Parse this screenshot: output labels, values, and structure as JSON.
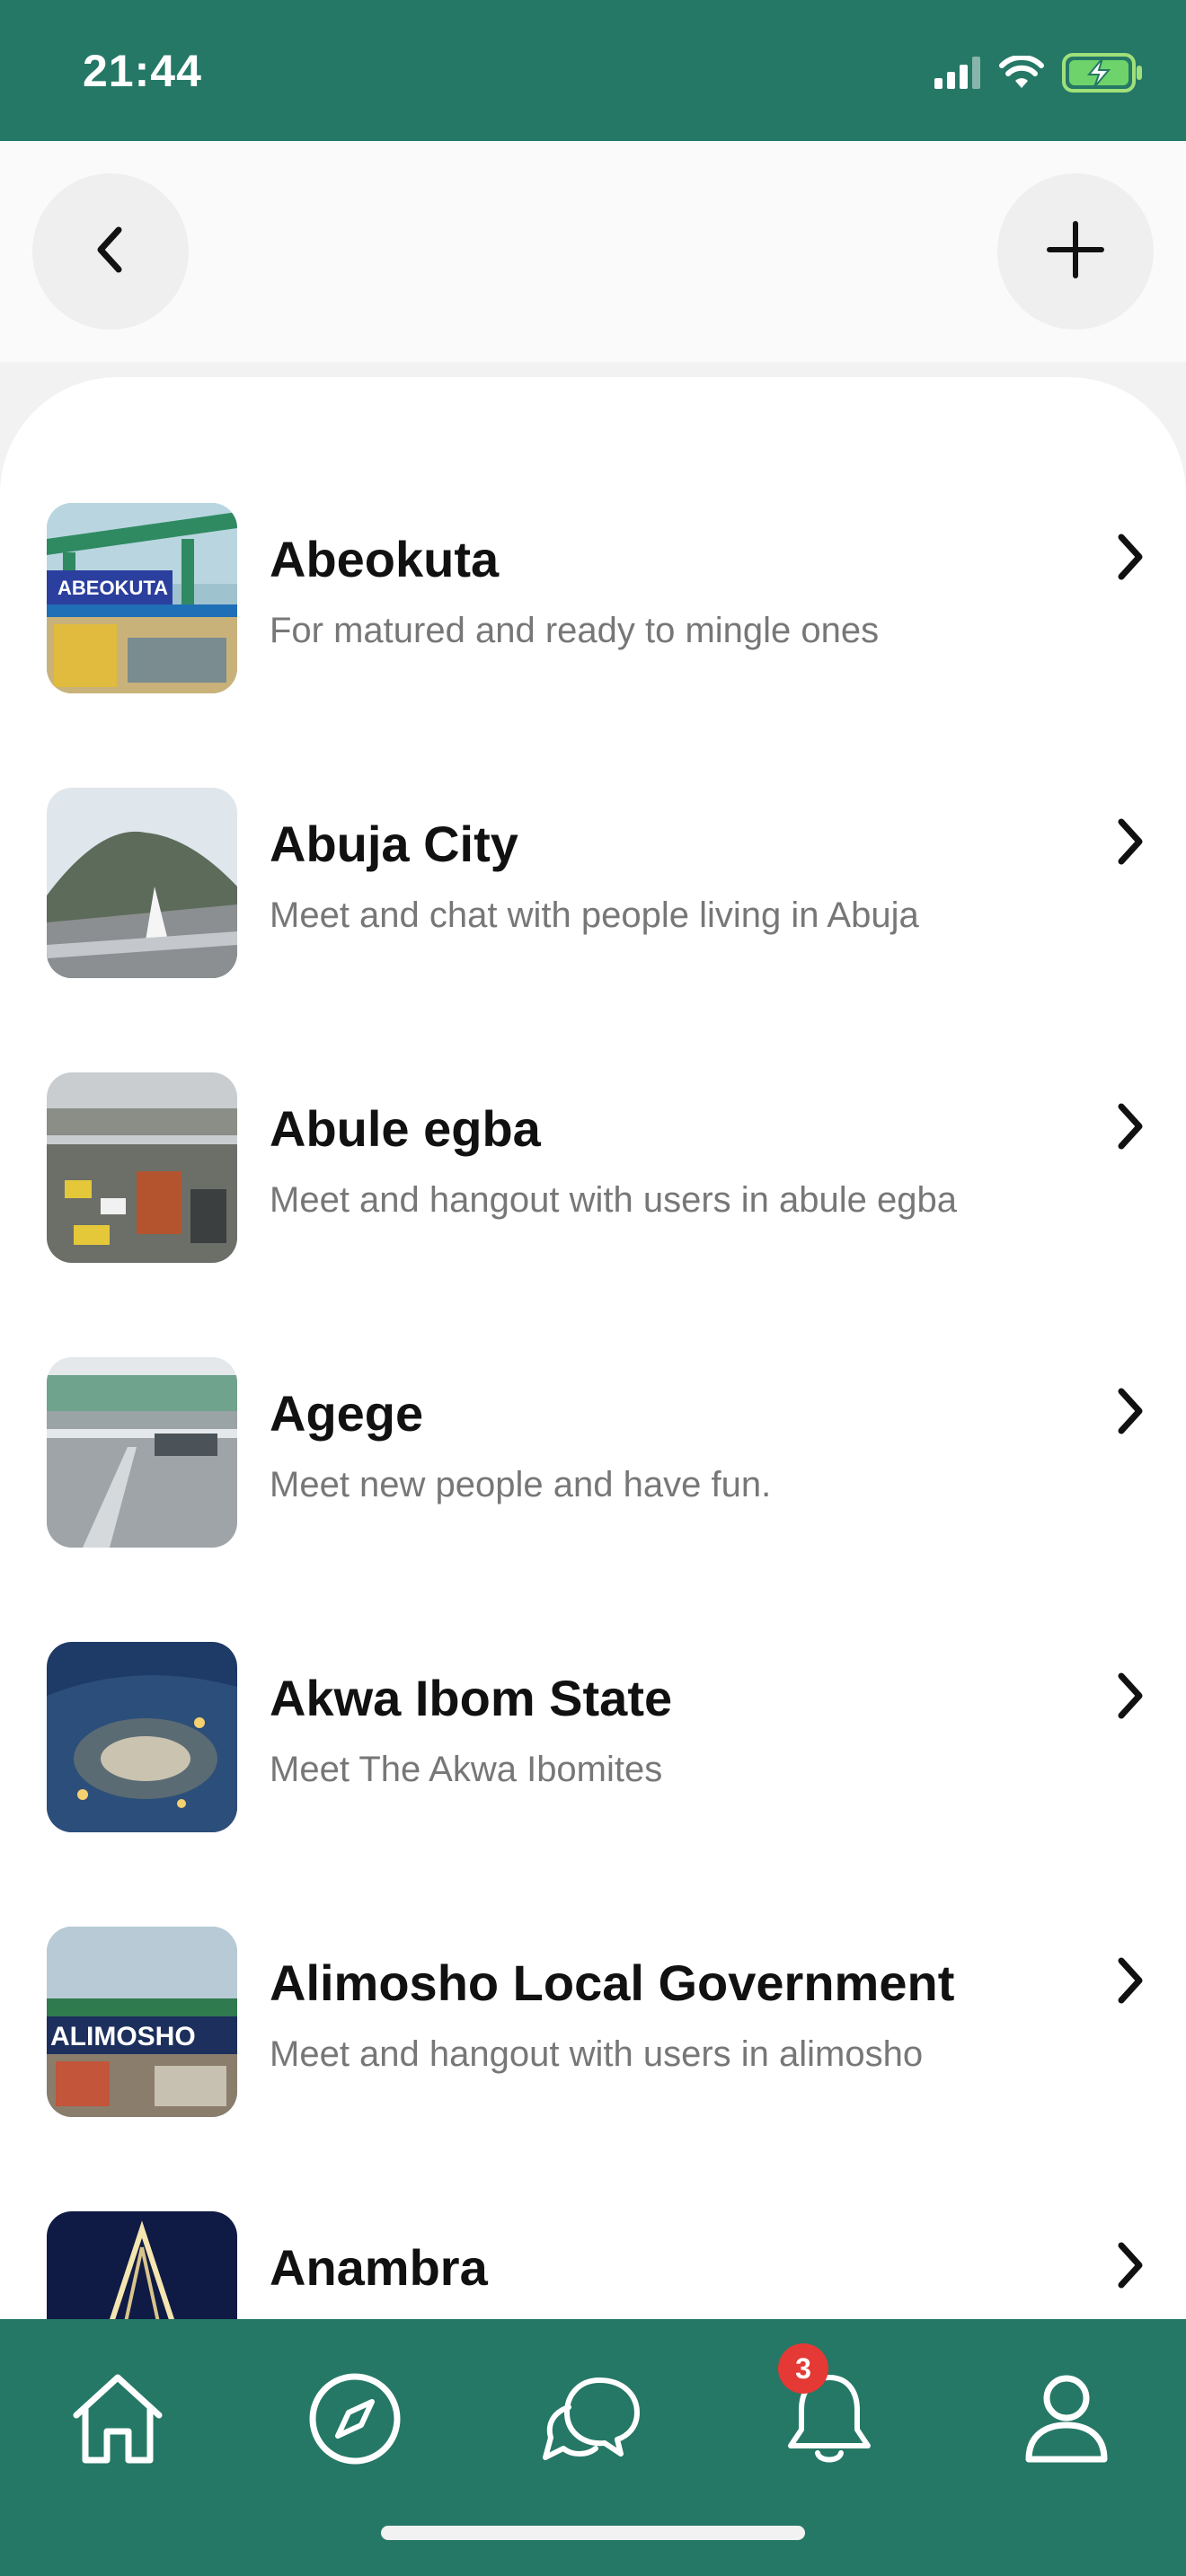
{
  "status_bar": {
    "time": "21:44",
    "icons": [
      "cellular-signal-icon",
      "wifi-icon",
      "battery-charging-icon"
    ]
  },
  "header": {
    "back_icon": "chevron-left-icon",
    "add_icon": "plus-icon"
  },
  "groups": [
    {
      "title": "Abeokuta",
      "subtitle": "For matured and ready to mingle ones",
      "thumb_label": "ABEOKUTA"
    },
    {
      "title": "Abuja City",
      "subtitle": "Meet and chat with people living in Abuja"
    },
    {
      "title": "Abule egba",
      "subtitle": "Meet and hangout with users in abule egba"
    },
    {
      "title": "Agege",
      "subtitle": "Meet new people and have fun."
    },
    {
      "title": "Akwa Ibom State",
      "subtitle": "Meet The Akwa Ibomites"
    },
    {
      "title": "Alimosho Local Government",
      "subtitle": "Meet and hangout with users in alimosho",
      "thumb_label": "ALIMOSHO"
    },
    {
      "title": "Anambra",
      "subtitle": ""
    }
  ],
  "bottom_nav": {
    "items": [
      "home-icon",
      "compass-icon",
      "chat-icon",
      "bell-icon",
      "profile-icon"
    ],
    "notification_count": "3"
  },
  "colors": {
    "brand": "#257866",
    "badge": "#e53935"
  }
}
